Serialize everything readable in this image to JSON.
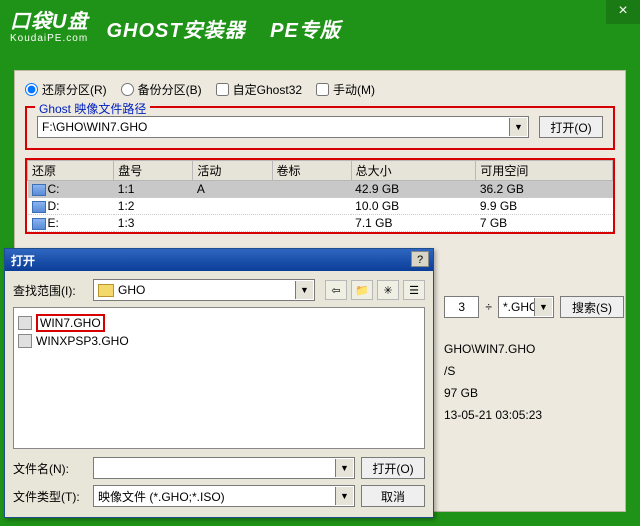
{
  "titlebar": {
    "logo_main": "口袋U盘",
    "logo_sub": "KoudaiPE.com",
    "app_title": "GHOST安装器",
    "edition": "PE专版"
  },
  "options": {
    "restore": "还原分区(R)",
    "backup": "备份分区(B)",
    "custom_ghost": "自定Ghost32",
    "manual": "手动(M)"
  },
  "path_group": {
    "legend": "Ghost 映像文件路径",
    "value": "F:\\GHO\\WIN7.GHO",
    "open_btn": "打开(O)"
  },
  "part_table": {
    "headers": [
      "还原",
      "盘号",
      "活动",
      "卷标",
      "总大小",
      "可用空间"
    ],
    "rows": [
      {
        "drv": "C:",
        "num": "1:1",
        "active": "A",
        "label": "",
        "total": "42.9 GB",
        "free": "36.2 GB"
      },
      {
        "drv": "D:",
        "num": "1:2",
        "active": "",
        "label": "",
        "total": "10.0 GB",
        "free": "9.9 GB"
      },
      {
        "drv": "E:",
        "num": "1:3",
        "active": "",
        "label": "",
        "total": "7.1 GB",
        "free": "7 GB"
      }
    ]
  },
  "dialog": {
    "title": "打开",
    "scope_label": "查找范围(I):",
    "scope_value": "GHO",
    "files": [
      {
        "name": "WIN7.GHO",
        "selected": true
      },
      {
        "name": "WINXPSP3.GHO",
        "selected": false
      }
    ],
    "file_name_label": "文件名(N):",
    "file_name_value": "",
    "file_type_label": "文件类型(T):",
    "file_type_value": "映像文件 (*.GHO;*.ISO)",
    "open_btn": "打开(O)",
    "cancel_btn": "取消"
  },
  "sidebar_info": {
    "number": "3",
    "filter": "*.GHO",
    "search_btn": "搜索(S)",
    "path_partial": "GHO\\WIN7.GHO",
    "vs_line": "/S",
    "size_line": "97 GB",
    "date_line": "13-05-21 03:05:23"
  }
}
